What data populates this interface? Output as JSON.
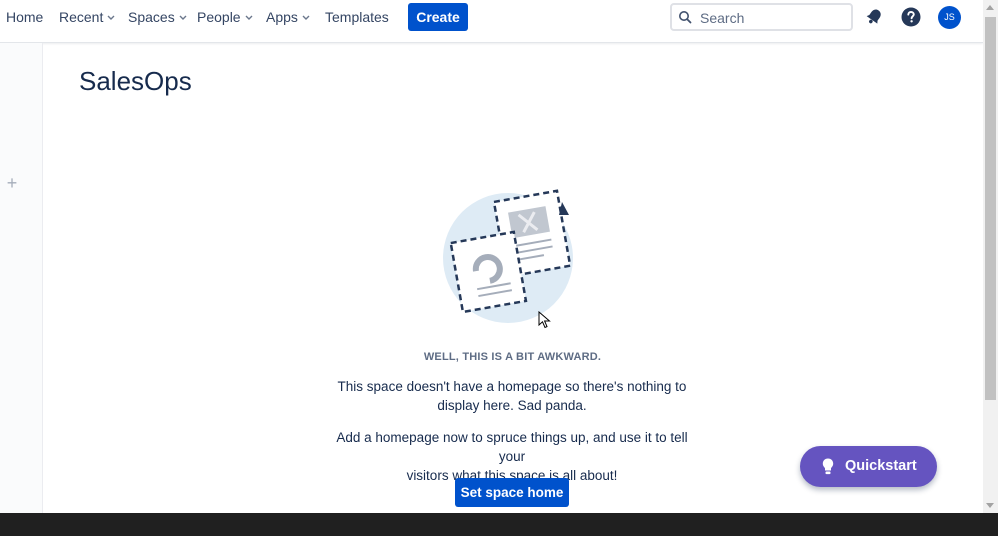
{
  "nav": {
    "home": "Home",
    "recent": "Recent",
    "spaces": "Spaces",
    "people": "People",
    "apps": "Apps",
    "templates": "Templates",
    "create": "Create",
    "search_placeholder": "Search",
    "avatar_initials": "JS"
  },
  "space": {
    "title": "SalesOps"
  },
  "empty_state": {
    "heading": "WELL, THIS IS A BIT AWKWARD.",
    "line1a": "This space doesn't have a homepage so there's nothing to",
    "line1b": "display here. Sad panda.",
    "line2a": "Add a homepage now to spruce things up, and use it to tell your",
    "line2b": "visitors what this space is all about!",
    "button": "Set space home"
  },
  "quickstart": {
    "label": "Quickstart"
  },
  "rail": {
    "plus": "+"
  },
  "colors": {
    "primary": "#0052cc",
    "quickstart": "#6554c0",
    "text": "#172b4d",
    "illustration_bg": "#deebf5",
    "illustration_dash": "#253858"
  }
}
